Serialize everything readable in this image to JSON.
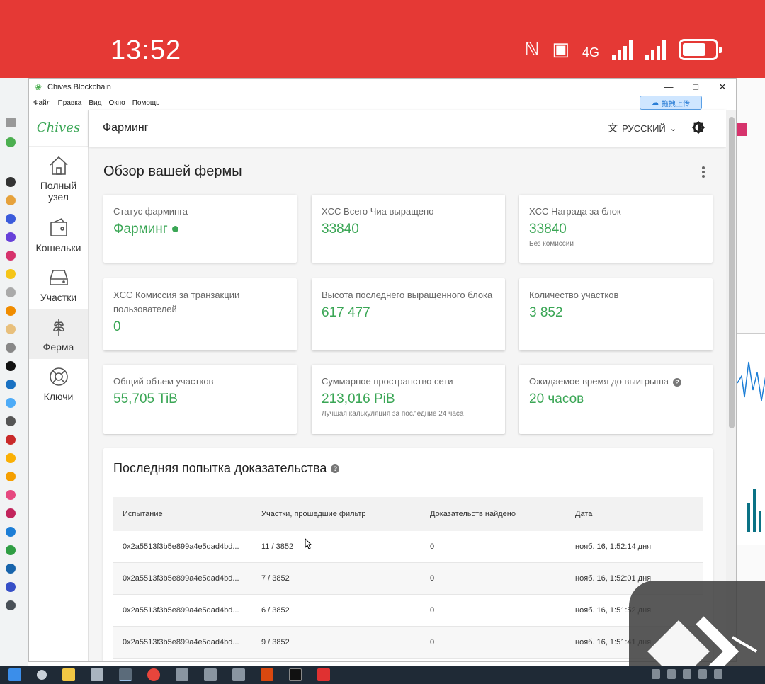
{
  "phone": {
    "time": "13:52",
    "network": "4G"
  },
  "window": {
    "title": "Chives Blockchain",
    "menu": [
      "Файл",
      "Правка",
      "Вид",
      "Окно",
      "Помощь"
    ],
    "upload_label": "拖拽上传"
  },
  "sidebar": {
    "logo": "Chives",
    "items": [
      {
        "label": "Полный узел",
        "icon": "home-icon"
      },
      {
        "label": "Кошельки",
        "icon": "wallet-icon"
      },
      {
        "label": "Участки",
        "icon": "hard-drive-icon"
      },
      {
        "label": "Ферма",
        "icon": "sprout-icon"
      },
      {
        "label": "Ключи",
        "icon": "lifebuoy-icon"
      }
    ]
  },
  "header": {
    "title": "Фарминг",
    "language": "РУССКИЙ"
  },
  "overview": {
    "title": "Обзор вашей фермы",
    "cards": [
      {
        "label": "Статус фарминга",
        "value": "Фарминг"
      },
      {
        "label": "XCC Всего Чиа выращено",
        "value": "33840"
      },
      {
        "label": "XCC Награда за блок",
        "value": "33840",
        "sub": "Без комиссии"
      },
      {
        "label": "XCC Комиссия за транзакции пользователей",
        "value": "0"
      },
      {
        "label": "Высота последнего выращенного блока",
        "value": "617 477"
      },
      {
        "label": "Количество участков",
        "value": "3 852"
      },
      {
        "label": "Общий объем участков",
        "value": "55,705 TiB"
      },
      {
        "label": "Суммарное пространство сети",
        "value": "213,016 PiB",
        "sub": "Лучшая калькуляция за последние 24 часа"
      },
      {
        "label": "Ожидаемое время до выигрыша",
        "value": "20 часов"
      }
    ]
  },
  "proofs": {
    "title": "Последняя попытка доказательства",
    "columns": [
      "Испытание",
      "Участки, прошедшие фильтр",
      "Доказательств найдено",
      "Дата"
    ],
    "rows": [
      [
        "0x2a5513f3b5e899a4e5dad4bd...",
        "11 / 3852",
        "0",
        "нояб. 16, 1:52:14 дня"
      ],
      [
        "0x2a5513f3b5e899a4e5dad4bd...",
        "7 / 3852",
        "0",
        "нояб. 16, 1:52:01 дня"
      ],
      [
        "0x2a5513f3b5e899a4e5dad4bd...",
        "6 / 3852",
        "0",
        "нояб. 16, 1:51:52 дня"
      ],
      [
        "0x2a5513f3b5e899a4e5dad4bd...",
        "9 / 3852",
        "0",
        "нояб. 16, 1:51:41 дня"
      ]
    ]
  },
  "colors": {
    "accent": "#3aa655",
    "status_bar": "#e53935"
  }
}
